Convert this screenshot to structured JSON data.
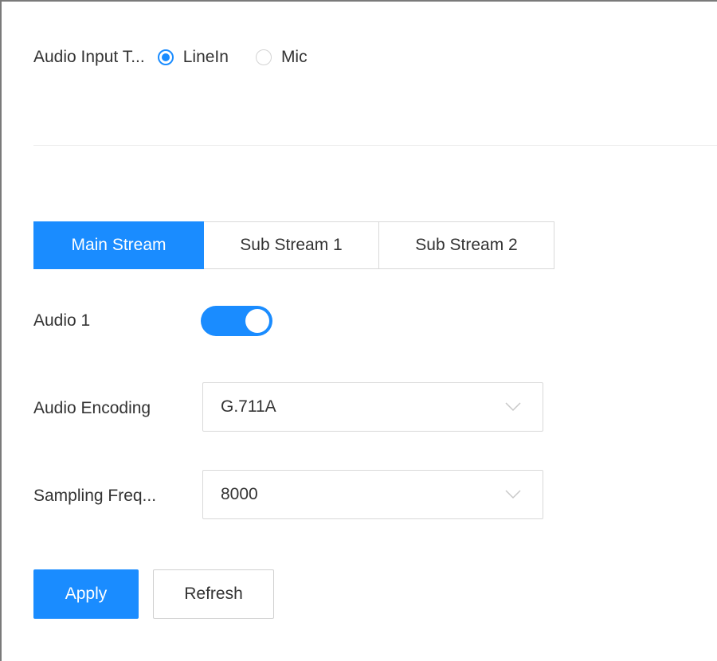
{
  "audio_input_type": {
    "label": "Audio Input T...",
    "options": [
      {
        "label": "LineIn",
        "checked": true
      },
      {
        "label": "Mic",
        "checked": false
      }
    ]
  },
  "tabs": [
    {
      "label": "Main Stream",
      "active": true
    },
    {
      "label": "Sub Stream 1",
      "active": false
    },
    {
      "label": "Sub Stream 2",
      "active": false
    }
  ],
  "audio1": {
    "label": "Audio 1",
    "enabled": true
  },
  "audio_encoding": {
    "label": "Audio Encoding",
    "value": "G.711A"
  },
  "sampling_frequency": {
    "label": "Sampling Freq...",
    "value": "8000"
  },
  "buttons": {
    "apply": "Apply",
    "refresh": "Refresh"
  },
  "colors": {
    "accent": "#1a8cff",
    "border": "#d9d9d9",
    "text": "#333333"
  }
}
